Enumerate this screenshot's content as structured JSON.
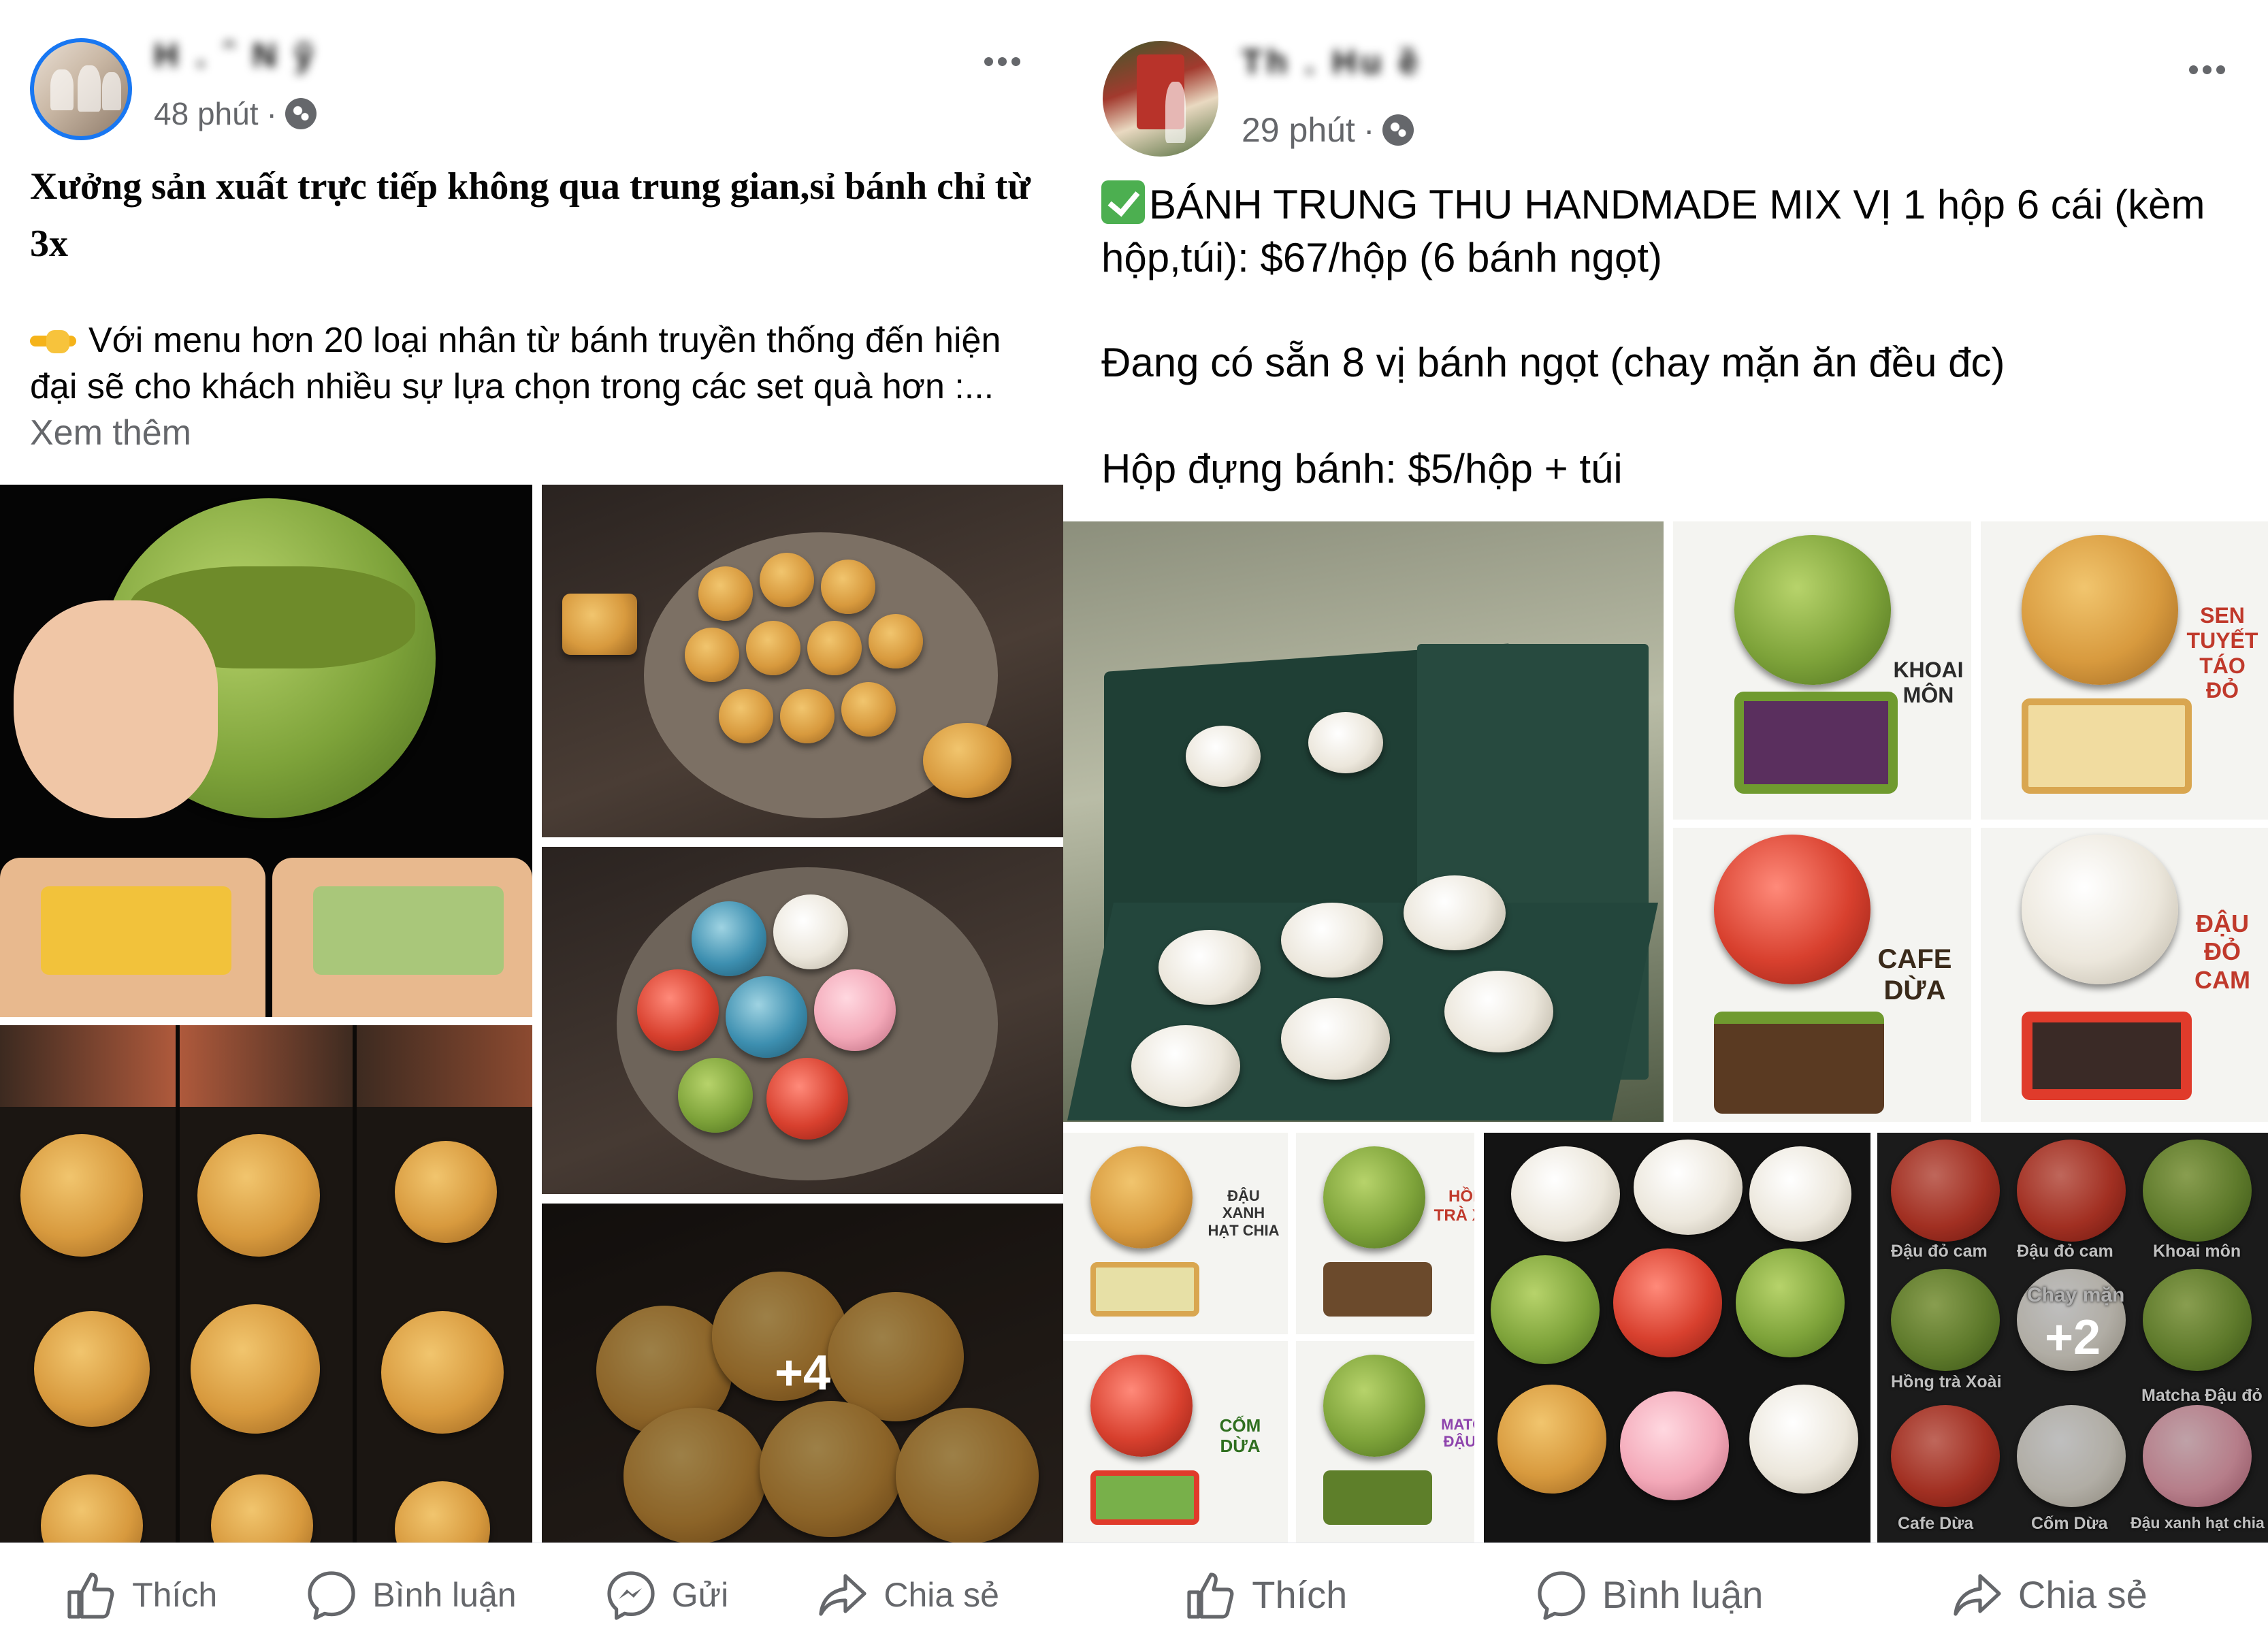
{
  "post_left": {
    "time": "48 phút",
    "separator": "·",
    "headline": "Xưởng sản xuất trực tiếp không qua trung gian,sỉ bánh chỉ từ 3x",
    "body": "Với menu hơn 20 loại nhân từ bánh truyền thống đến hiện đại sẽ cho khách nhiều sự lựa chọn trong các set quà hơn :...",
    "see_more": "Xem thêm",
    "more_photos": "+4",
    "actions": {
      "like": "Thích",
      "comment": "Bình luận",
      "send": "Gửi",
      "share": "Chia sẻ"
    }
  },
  "post_right": {
    "time": "29 phút",
    "separator": "·",
    "paragraph_1": "BÁNH TRUNG THU HANDMADE MIX VỊ 1 hộp 6 cái (kèm hộp,túi): $67/hộp (6 bánh ngọt)",
    "paragraph_2": "Đang có sẵn 8 vị bánh ngọt (chay mặn ăn đều đc)",
    "paragraph_3": "Hộp đựng bánh: $5/hộp + túi",
    "flavors": {
      "khoai_mon": "KHOAI MÔN",
      "sen_tuyet": "SEN TUYẾT TÁO ĐỎ",
      "cafe_dua": "CAFE DỪA",
      "dau_do_cam": "ĐẬU ĐỎ CAM",
      "dau_xanh_hat_chia": "ĐẬU XANH HẠT CHIA",
      "hong_tra_xoai": "HỒNG TRÀ XOÀI",
      "com_dua": "CỐM DỪA",
      "matcha_dau_do": "MATCHA ĐẬU ĐỎ"
    },
    "grid_labels": {
      "c1": "Đậu đỏ cam",
      "c2": "Đậu đỏ cam",
      "c3": "Khoai môn",
      "c4": "Hồng trà Xoài",
      "c5": "Matcha Đậu đỏ",
      "c6": "Cafe Dừa",
      "c7": "Cốm Dừa",
      "c8": "Đậu xanh hạt chia",
      "c9": "Chay mặn"
    },
    "more_photos": "+2",
    "actions": {
      "like": "Thích",
      "comment": "Bình luận",
      "share": "Chia sẻ"
    }
  }
}
